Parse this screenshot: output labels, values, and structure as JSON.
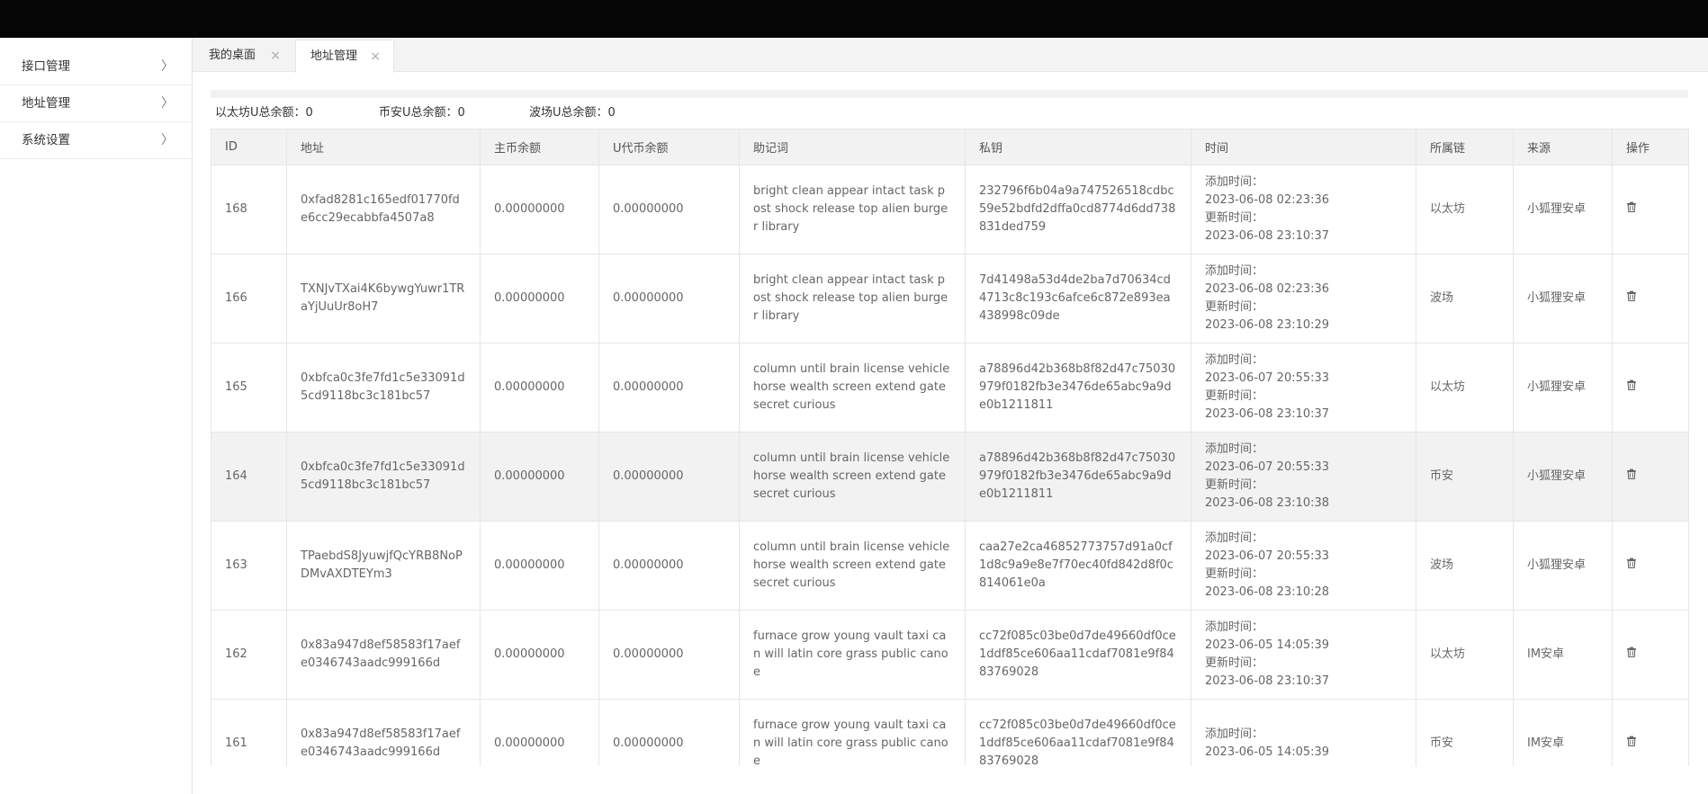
{
  "sidebar": {
    "items": [
      {
        "label": "接口管理"
      },
      {
        "label": "地址管理"
      },
      {
        "label": "系统设置"
      }
    ]
  },
  "tabs": [
    {
      "label": "我的桌面"
    },
    {
      "label": "地址管理"
    }
  ],
  "summary": {
    "eth": "以太坊U总余额：0",
    "bsc": "币安U总余额：0",
    "tron": "波场U总余额：0"
  },
  "table": {
    "headers": [
      "ID",
      "地址",
      "主币余额",
      "U代币余额",
      "助记词",
      "私钥",
      "时间",
      "所属链",
      "来源",
      "操作"
    ],
    "rows": [
      {
        "id": "168",
        "address": "0xfad8281c165edf01770fde6cc29ecabbfa4507a8",
        "main": "0.00000000",
        "token": "0.00000000",
        "mnemonic": "bright clean appear intact task post shock release top alien burger library",
        "key": "232796f6b04a9a747526518cdbc59e52bdfd2dffa0cd8774d6dd738831ded759",
        "added_label": "添加时间：",
        "added": "2023-06-08 02:23:36",
        "updated_label": "更新时间：",
        "updated": "2023-06-08 23:10:37",
        "chain": "以太坊",
        "source": "小狐狸安卓"
      },
      {
        "id": "166",
        "address": "TXNJvTXai4K6bywgYuwr1TRaYjUuUr8oH7",
        "main": "0.00000000",
        "token": "0.00000000",
        "mnemonic": "bright clean appear intact task post shock release top alien burger library",
        "key": "7d41498a53d4de2ba7d70634cd4713c8c193c6afce6c872e893ea438998c09de",
        "added_label": "添加时间：",
        "added": "2023-06-08 02:23:36",
        "updated_label": "更新时间：",
        "updated": "2023-06-08 23:10:29",
        "chain": "波场",
        "source": "小狐狸安卓"
      },
      {
        "id": "165",
        "address": "0xbfca0c3fe7fd1c5e33091d5cd9118bc3c181bc57",
        "main": "0.00000000",
        "token": "0.00000000",
        "mnemonic": "column until brain license vehicle horse wealth screen extend gate secret curious",
        "key": "a78896d42b368b8f82d47c75030979f0182fb3e3476de65abc9a9de0b1211811",
        "added_label": "添加时间：",
        "added": "2023-06-07 20:55:33",
        "updated_label": "更新时间：",
        "updated": "2023-06-08 23:10:37",
        "chain": "以太坊",
        "source": "小狐狸安卓"
      },
      {
        "id": "164",
        "address": "0xbfca0c3fe7fd1c5e33091d5cd9118bc3c181bc57",
        "main": "0.00000000",
        "token": "0.00000000",
        "mnemonic": "column until brain license vehicle horse wealth screen extend gate secret curious",
        "key": "a78896d42b368b8f82d47c75030979f0182fb3e3476de65abc9a9de0b1211811",
        "added_label": "添加时间：",
        "added": "2023-06-07 20:55:33",
        "updated_label": "更新时间：",
        "updated": "2023-06-08 23:10:38",
        "chain": "币安",
        "source": "小狐狸安卓"
      },
      {
        "id": "163",
        "address": "TPaebdS8JyuwjfQcYRB8NoPDMvAXDTEYm3",
        "main": "0.00000000",
        "token": "0.00000000",
        "mnemonic": "column until brain license vehicle horse wealth screen extend gate secret curious",
        "key": "caa27e2ca46852773757d91a0cf1d8c9a9e8e7f70ec40fd842d8f0c814061e0a",
        "added_label": "添加时间：",
        "added": "2023-06-07 20:55:33",
        "updated_label": "更新时间：",
        "updated": "2023-06-08 23:10:28",
        "chain": "波场",
        "source": "小狐狸安卓"
      },
      {
        "id": "162",
        "address": "0x83a947d8ef58583f17aefe0346743aadc999166d",
        "main": "0.00000000",
        "token": "0.00000000",
        "mnemonic": "furnace grow young vault taxi can will latin core grass public canoe",
        "key": "cc72f085c03be0d7de49660df0ce1ddf85ce606aa11cdaf7081e9f8483769028",
        "added_label": "添加时间：",
        "added": "2023-06-05 14:05:39",
        "updated_label": "更新时间：",
        "updated": "2023-06-08 23:10:37",
        "chain": "以太坊",
        "source": "IM安卓"
      },
      {
        "id": "161",
        "address": "0x83a947d8ef58583f17aefe0346743aadc999166d",
        "main": "0.00000000",
        "token": "0.00000000",
        "mnemonic": "furnace grow young vault taxi can will latin core grass public canoe",
        "key": "cc72f085c03be0d7de49660df0ce1ddf85ce606aa11cdaf7081e9f8483769028",
        "added_label": "添加时间：",
        "added": "2023-06-05 14:05:39",
        "updated_label": "",
        "updated": "",
        "chain": "币安",
        "source": "IM安卓"
      }
    ]
  },
  "icons": {
    "sidebar_chevron": "chevron-right-icon",
    "tab_close": "close-icon",
    "delete": "trash-icon"
  },
  "colors": {
    "topbar": "#050505",
    "header_bg": "#f2f2f2",
    "border": "#e6e6e6"
  }
}
